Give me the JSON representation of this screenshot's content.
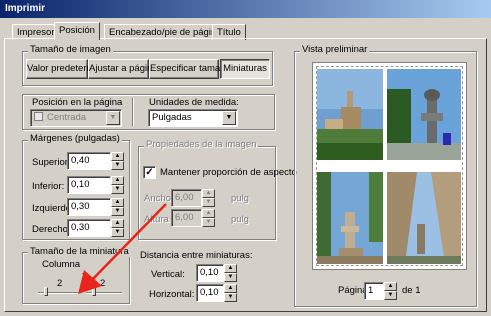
{
  "window": {
    "title": "Imprimir"
  },
  "tabs": [
    {
      "label": "Impresora"
    },
    {
      "label": "Posición"
    },
    {
      "label": "Encabezado/pie de página"
    },
    {
      "label": "Título"
    }
  ],
  "image_size": {
    "title": "Tamaño de imagen",
    "buttons": [
      "Valor predeterm.",
      "Ajustar a página",
      "Especificar tamaño",
      "Miniaturas"
    ]
  },
  "position": {
    "label": "Posición en la página",
    "value": "Centrada"
  },
  "units": {
    "label": "Unidades de medida:",
    "value": "Pulgadas"
  },
  "margins": {
    "title": "Márgenes (pulgadas)",
    "top_label": "Superior:",
    "top": "0,40",
    "bottom_label": "Inferior:",
    "bottom": "0,10",
    "left_label": "Izquierdo:",
    "left": "0,30",
    "right_label": "Derecho:",
    "right": "0,30"
  },
  "image_props": {
    "title": "Propiedades de la imagen",
    "keep_aspect": "Mantener proporción de aspecto",
    "width_label": "Ancho",
    "width": "6,00",
    "width_unit": "pulg",
    "height_label": "Altura",
    "height": "6,00",
    "height_unit": "pulg"
  },
  "thumb_size": {
    "title": "Tamaño de la miniatura",
    "column_label": "Columna",
    "columns": "2",
    "x": "x",
    "rows": "2"
  },
  "thumb_spacing": {
    "title": "Distancia entre miniaturas:",
    "vertical_label": "Vertical:",
    "vertical": "0,10",
    "horizontal_label": "Horizontal:",
    "horizontal": "0,10"
  },
  "preview": {
    "title": "Vista preliminar",
    "page_label": "Página",
    "page": "1",
    "of_label": "de 1"
  },
  "icons": {
    "spin_up": "▲",
    "spin_down": "▼",
    "dropdown": "▼",
    "check": "✓"
  },
  "colors": {
    "titlebar": "#0a246a",
    "arrow": "#e8251b",
    "window": "#d4d0c8"
  }
}
